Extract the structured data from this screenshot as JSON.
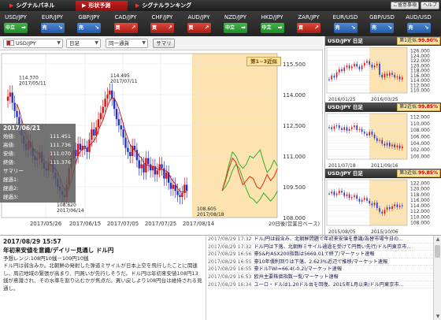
{
  "topbar": {
    "tabs": [
      {
        "label": "シグナルパネル",
        "active": false
      },
      {
        "label": "形状予測",
        "active": true
      },
      {
        "label": "シグナルランキング",
        "active": false
      }
    ],
    "buttons": {
      "notice": "ご留意事項",
      "help": "ヘルプ"
    }
  },
  "currencies": [
    {
      "pair": "USD/JPY",
      "signal": "中立",
      "icon": "arrow-right-icon",
      "color": "green"
    },
    {
      "pair": "EUR/JPY",
      "signal": "売",
      "icon": "arrow-down-icon",
      "color": "blue"
    },
    {
      "pair": "GBP/JPY",
      "signal": "売",
      "icon": "arrow-down-icon",
      "color": "blue"
    },
    {
      "pair": "CAD/JPY",
      "signal": "買",
      "icon": "arrow-up-icon",
      "color": "red"
    },
    {
      "pair": "CHF/JPY",
      "signal": "買",
      "icon": "arrow-up-icon",
      "color": "red"
    },
    {
      "pair": "AUD/JPY",
      "signal": "買",
      "icon": "arrow-up-icon",
      "color": "red"
    },
    {
      "pair": "NZD/JPY",
      "signal": "中立",
      "icon": "arrow-right-icon",
      "color": "green"
    },
    {
      "pair": "HKD/JPY",
      "signal": "中立",
      "icon": "arrow-right-icon",
      "color": "green"
    },
    {
      "pair": "ZAR/JPY",
      "signal": "買",
      "icon": "arrow-up-icon",
      "color": "red"
    },
    {
      "pair": "EUR/USD",
      "signal": "売",
      "icon": "arrow-down-icon",
      "color": "blue"
    },
    {
      "pair": "GBP/USD",
      "signal": "売",
      "icon": "arrow-down-icon",
      "color": "blue"
    },
    {
      "pair": "AUD/USD",
      "signal": "売",
      "icon": "arrow-down-icon",
      "color": "blue"
    }
  ],
  "controls": {
    "pair": "USD/JPY",
    "period": "日足",
    "compare": "同一通貨",
    "summary_button": "サマリ"
  },
  "main_chart": {
    "forecast_label": "第1~3近似",
    "ylim": [
      108.0,
      116.0
    ],
    "yticks": [
      "115.500",
      "114.000",
      "112.500",
      "111.000",
      "109.500",
      "108.000"
    ],
    "xticks": [
      "2017/05/26",
      "2017/06/15",
      "2017/07/05",
      "2017/07/25",
      "2017/08/14"
    ],
    "footer": "20日後(営業日ベース)",
    "annotations": [
      {
        "price": "114.370",
        "date": "2017/05/11"
      },
      {
        "price": "114.495",
        "date": "2017/07/11"
      },
      {
        "price": "108.820",
        "date": "2017/06/14"
      },
      {
        "price": "108.605",
        "date": "2017/08/18"
      }
    ],
    "colors": {
      "up": "#dd1111",
      "down": "#2233cc",
      "ma": "#cc1111",
      "forecast_bg": "#fde3b0",
      "forecast_red": "#e03a1a",
      "forecast_green": "#2fb02f"
    }
  },
  "tooltip": {
    "date": "2017/06/21",
    "rows": [
      {
        "label": "始値:",
        "value": "111.451"
      },
      {
        "label": "高値:",
        "value": "111.736"
      },
      {
        "label": "安値:",
        "value": "111.070"
      },
      {
        "label": "終値:",
        "value": "111.376"
      },
      {
        "label": "サマリー",
        "value": ""
      },
      {
        "label": "経過1:",
        "value": ""
      },
      {
        "label": "経過2:",
        "value": ""
      },
      {
        "label": "経過3:",
        "value": ""
      }
    ]
  },
  "mini_charts": [
    {
      "title": "USD/JPY 日足",
      "rank_label": "第1近似:",
      "rate": "99.90%",
      "yticks": [
        "126.000",
        "124.000",
        "122.000",
        "120.000",
        "118.000",
        "116.000",
        "114.000",
        "112.000",
        "110.000"
      ],
      "xticks": [
        "2016/01/25",
        "2016/03/25"
      ]
    },
    {
      "title": "USD/JPY 日足",
      "rank_label": "第2近似:",
      "rate": "99.85%",
      "yticks": [
        "112.000",
        "110.000",
        "108.000",
        "106.000",
        "104.000",
        "102.000",
        "100.000"
      ],
      "xticks": [
        "2011/07/18",
        "2011/09/16"
      ]
    },
    {
      "title": "USD/JPY 日足",
      "rank_label": "第3近似:",
      "rate": "99.85%",
      "yticks": [
        "122.000",
        "120.000",
        "118.000",
        "116.000",
        "114.000",
        "112.000",
        "110.000",
        "108.000"
      ],
      "xticks": [
        "2015/08/05",
        "2015/10/06"
      ]
    }
  ],
  "article": {
    "timestamp": "2017/08/29 15:57",
    "title": "年初来安値を意識/デイリー見通し ドル円",
    "range": "予想レンジ:108円10銭－109円10銭",
    "body": "ドル円は弱含みか。北朝鮮の発射した弾道ミサイルが日本上空を飛行したことに関連し、周辺地域の緊張が高まり、円買いが先行しそうだ。ドル円は年初来安値108円13銭が意識され、その水準を割り込むかが焦点だ。買い戻しより108円台は維持される見通し。"
  },
  "news": [
    {
      "time": "2017/08/29 17:32",
      "headline": "ドル/円は弱含み、北朝鮮問題で年初来安値を意識/為替市場今日の..."
    },
    {
      "time": "2017/08/29 17:32",
      "headline": "ドル円は下落、北朝鮮ミサイル通過を受けて円買い先行/ドル円東京市..."
    },
    {
      "time": "2017/08/29 16:56",
      "headline": "豪S&P/ASX200指数は5669.01で終了/マーケット速報"
    },
    {
      "time": "2017/08/29 16:55",
      "headline": "豪10年債利回りは下落、2.623%近辺で推移/マーケット速報"
    },
    {
      "time": "2017/08/29 16:55",
      "headline": "豪ドルTWI=66.4(-0.2)/マーケット速報"
    },
    {
      "time": "2017/08/29 16:53",
      "headline": "欧州主要株価指数一覧/マーケット速報"
    },
    {
      "time": "2017/08/29 16:34",
      "headline": "ユーロ・ドルは1.20ドル台を回復、2015年1月以来/ドル円東京市..."
    }
  ]
}
